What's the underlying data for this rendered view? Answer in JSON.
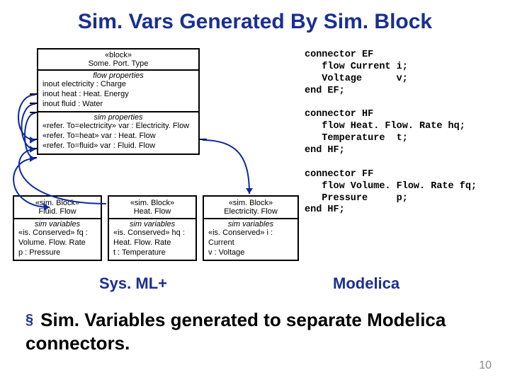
{
  "title": "Sim. Vars Generated By Sim. Block",
  "mainBlock": {
    "stereo": "«block»",
    "name": "Some. Port. Type",
    "flowTitle": "flow properties",
    "flow": [
      "inout electricity : Charge",
      "inout heat : Heat. Energy",
      "inout fluid : Water"
    ],
    "simTitle": "sim properties",
    "sim": [
      "«refer. To=electricity» var : Electricity. Flow",
      "«refer. To=heat» var : Heat. Flow",
      "«refer. To=fluid» var : Fluid. Flow"
    ]
  },
  "simBlocks": [
    {
      "stereo": "«sim. Block»",
      "name": "Fluid. Flow",
      "varsTitle": "sim variables",
      "vars": "«is. Conserved» fq  :  Volume. Flow. Rate\np : Pressure"
    },
    {
      "stereo": "«sim. Block»",
      "name": "Heat. Flow",
      "varsTitle": "sim variables",
      "vars": "«is. Conserved» hq  :  Heat. Flow. Rate\nt : Temperature"
    },
    {
      "stereo": "«sim. Block»",
      "name": "Electricity. Flow",
      "varsTitle": "sim variables",
      "vars": "«is. Conserved» i  : Current\nv : Voltage"
    }
  ],
  "code": "connector EF\n   flow Current i;\n   Voltage      v;\nend EF;\n\nconnector HF\n   flow Heat. Flow. Rate hq;\n   Temperature  t;\nend HF;\n\nconnector FF\n   flow Volume. Flow. Rate fq;\n   Pressure     p;\nend HF;",
  "labels": {
    "sysml": "Sys. ML+",
    "modelica": "Modelica"
  },
  "bullet": "Sim. Variables generated to separate Modelica connectors.",
  "page": "10"
}
